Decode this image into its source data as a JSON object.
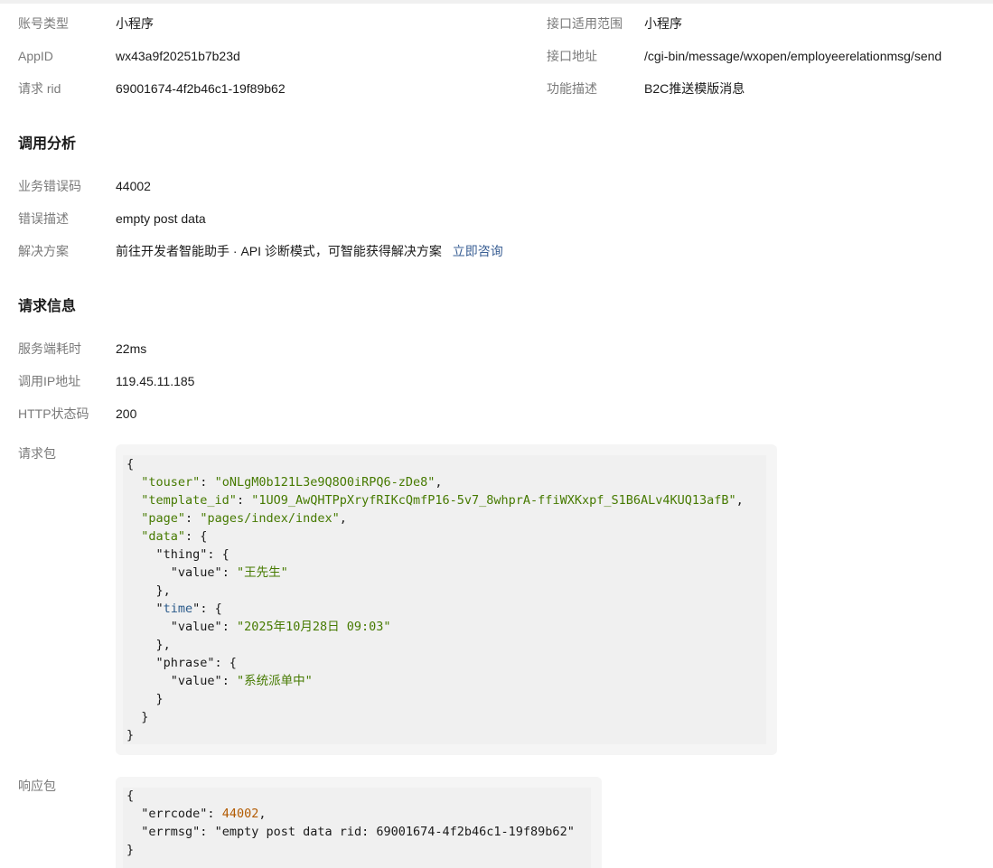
{
  "account_info": {
    "account_type_label": "账号类型",
    "account_type_value": "小程序",
    "appid_label": "AppID",
    "appid_value": "wx43a9f20251b7b23d",
    "rid_label": "请求 rid",
    "rid_value": "69001674-4f2b46c1-19f89b62",
    "scope_label": "接口适用范围",
    "scope_value": "小程序",
    "endpoint_label": "接口地址",
    "endpoint_value": "/cgi-bin/message/wxopen/employeerelationmsg/send",
    "description_label": "功能描述",
    "description_value": "B2C推送模版消息"
  },
  "analysis": {
    "title": "调用分析",
    "error_code_label": "业务错误码",
    "error_code_value": "44002",
    "error_desc_label": "错误描述",
    "error_desc_value": "empty post data",
    "solution_label": "解决方案",
    "solution_value": "前往开发者智能助手 · API 诊断模式，可智能获得解决方案",
    "solution_link": "立即咨询"
  },
  "request_info": {
    "title": "请求信息",
    "latency_label": "服务端耗时",
    "latency_value": "22ms",
    "ip_label": "调用IP地址",
    "ip_value": "119.45.11.185",
    "http_status_label": "HTTP状态码",
    "http_status_value": "200",
    "request_body_label": "请求包",
    "response_body_label": "响应包"
  },
  "request_body": {
    "touser_key": "\"touser\"",
    "touser_value": "\"oNLgM0b121L3e9Q8O0iRPQ6-zDe8\"",
    "template_id_key": "\"template_id\"",
    "template_id_value": "\"1UO9_AwQHTPpXryfRIKcQmfP16-5v7_8whprA-ffiWXKxpf_S1B6ALv4KUQ13afB\"",
    "page_key": "\"page\"",
    "page_value": "\"pages/index/index\"",
    "data_key": "\"data\"",
    "thing_key": "\"thing\"",
    "thing_value_key": "\"value\"",
    "thing_value": "\"王先生\"",
    "time_key_open": "\"",
    "time_key_word": "time",
    "time_key_close": "\"",
    "time_value_key": "\"value\"",
    "time_value": "\"2025年10月28日 09:03\"",
    "phrase_key": "\"phrase\"",
    "phrase_value_key": "\"value\"",
    "phrase_value": "\"系统派单中\""
  },
  "response_body": {
    "errcode_key": "\"errcode\"",
    "errcode_value": "44002",
    "errmsg_key": "\"errmsg\"",
    "errmsg_value": "\"empty post data rid: 69001674-4f2b46c1-19f89b62\""
  }
}
